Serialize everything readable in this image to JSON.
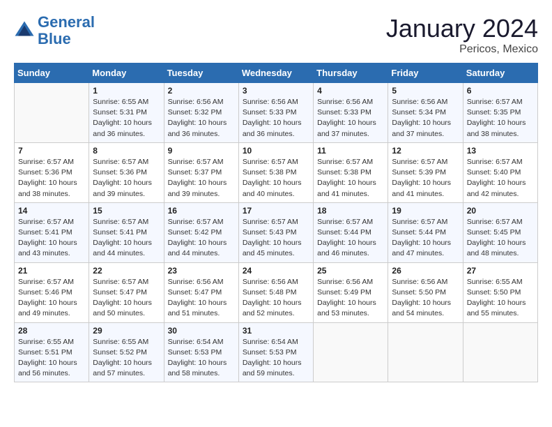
{
  "header": {
    "logo_line1": "General",
    "logo_line2": "Blue",
    "month": "January 2024",
    "location": "Pericos, Mexico"
  },
  "weekdays": [
    "Sunday",
    "Monday",
    "Tuesday",
    "Wednesday",
    "Thursday",
    "Friday",
    "Saturday"
  ],
  "weeks": [
    [
      {
        "day": "",
        "info": ""
      },
      {
        "day": "1",
        "info": "Sunrise: 6:55 AM\nSunset: 5:31 PM\nDaylight: 10 hours\nand 36 minutes."
      },
      {
        "day": "2",
        "info": "Sunrise: 6:56 AM\nSunset: 5:32 PM\nDaylight: 10 hours\nand 36 minutes."
      },
      {
        "day": "3",
        "info": "Sunrise: 6:56 AM\nSunset: 5:33 PM\nDaylight: 10 hours\nand 36 minutes."
      },
      {
        "day": "4",
        "info": "Sunrise: 6:56 AM\nSunset: 5:33 PM\nDaylight: 10 hours\nand 37 minutes."
      },
      {
        "day": "5",
        "info": "Sunrise: 6:56 AM\nSunset: 5:34 PM\nDaylight: 10 hours\nand 37 minutes."
      },
      {
        "day": "6",
        "info": "Sunrise: 6:57 AM\nSunset: 5:35 PM\nDaylight: 10 hours\nand 38 minutes."
      }
    ],
    [
      {
        "day": "7",
        "info": "Sunrise: 6:57 AM\nSunset: 5:36 PM\nDaylight: 10 hours\nand 38 minutes."
      },
      {
        "day": "8",
        "info": "Sunrise: 6:57 AM\nSunset: 5:36 PM\nDaylight: 10 hours\nand 39 minutes."
      },
      {
        "day": "9",
        "info": "Sunrise: 6:57 AM\nSunset: 5:37 PM\nDaylight: 10 hours\nand 39 minutes."
      },
      {
        "day": "10",
        "info": "Sunrise: 6:57 AM\nSunset: 5:38 PM\nDaylight: 10 hours\nand 40 minutes."
      },
      {
        "day": "11",
        "info": "Sunrise: 6:57 AM\nSunset: 5:38 PM\nDaylight: 10 hours\nand 41 minutes."
      },
      {
        "day": "12",
        "info": "Sunrise: 6:57 AM\nSunset: 5:39 PM\nDaylight: 10 hours\nand 41 minutes."
      },
      {
        "day": "13",
        "info": "Sunrise: 6:57 AM\nSunset: 5:40 PM\nDaylight: 10 hours\nand 42 minutes."
      }
    ],
    [
      {
        "day": "14",
        "info": "Sunrise: 6:57 AM\nSunset: 5:41 PM\nDaylight: 10 hours\nand 43 minutes."
      },
      {
        "day": "15",
        "info": "Sunrise: 6:57 AM\nSunset: 5:41 PM\nDaylight: 10 hours\nand 44 minutes."
      },
      {
        "day": "16",
        "info": "Sunrise: 6:57 AM\nSunset: 5:42 PM\nDaylight: 10 hours\nand 44 minutes."
      },
      {
        "day": "17",
        "info": "Sunrise: 6:57 AM\nSunset: 5:43 PM\nDaylight: 10 hours\nand 45 minutes."
      },
      {
        "day": "18",
        "info": "Sunrise: 6:57 AM\nSunset: 5:44 PM\nDaylight: 10 hours\nand 46 minutes."
      },
      {
        "day": "19",
        "info": "Sunrise: 6:57 AM\nSunset: 5:44 PM\nDaylight: 10 hours\nand 47 minutes."
      },
      {
        "day": "20",
        "info": "Sunrise: 6:57 AM\nSunset: 5:45 PM\nDaylight: 10 hours\nand 48 minutes."
      }
    ],
    [
      {
        "day": "21",
        "info": "Sunrise: 6:57 AM\nSunset: 5:46 PM\nDaylight: 10 hours\nand 49 minutes."
      },
      {
        "day": "22",
        "info": "Sunrise: 6:57 AM\nSunset: 5:47 PM\nDaylight: 10 hours\nand 50 minutes."
      },
      {
        "day": "23",
        "info": "Sunrise: 6:56 AM\nSunset: 5:47 PM\nDaylight: 10 hours\nand 51 minutes."
      },
      {
        "day": "24",
        "info": "Sunrise: 6:56 AM\nSunset: 5:48 PM\nDaylight: 10 hours\nand 52 minutes."
      },
      {
        "day": "25",
        "info": "Sunrise: 6:56 AM\nSunset: 5:49 PM\nDaylight: 10 hours\nand 53 minutes."
      },
      {
        "day": "26",
        "info": "Sunrise: 6:56 AM\nSunset: 5:50 PM\nDaylight: 10 hours\nand 54 minutes."
      },
      {
        "day": "27",
        "info": "Sunrise: 6:55 AM\nSunset: 5:50 PM\nDaylight: 10 hours\nand 55 minutes."
      }
    ],
    [
      {
        "day": "28",
        "info": "Sunrise: 6:55 AM\nSunset: 5:51 PM\nDaylight: 10 hours\nand 56 minutes."
      },
      {
        "day": "29",
        "info": "Sunrise: 6:55 AM\nSunset: 5:52 PM\nDaylight: 10 hours\nand 57 minutes."
      },
      {
        "day": "30",
        "info": "Sunrise: 6:54 AM\nSunset: 5:53 PM\nDaylight: 10 hours\nand 58 minutes."
      },
      {
        "day": "31",
        "info": "Sunrise: 6:54 AM\nSunset: 5:53 PM\nDaylight: 10 hours\nand 59 minutes."
      },
      {
        "day": "",
        "info": ""
      },
      {
        "day": "",
        "info": ""
      },
      {
        "day": "",
        "info": ""
      }
    ]
  ]
}
